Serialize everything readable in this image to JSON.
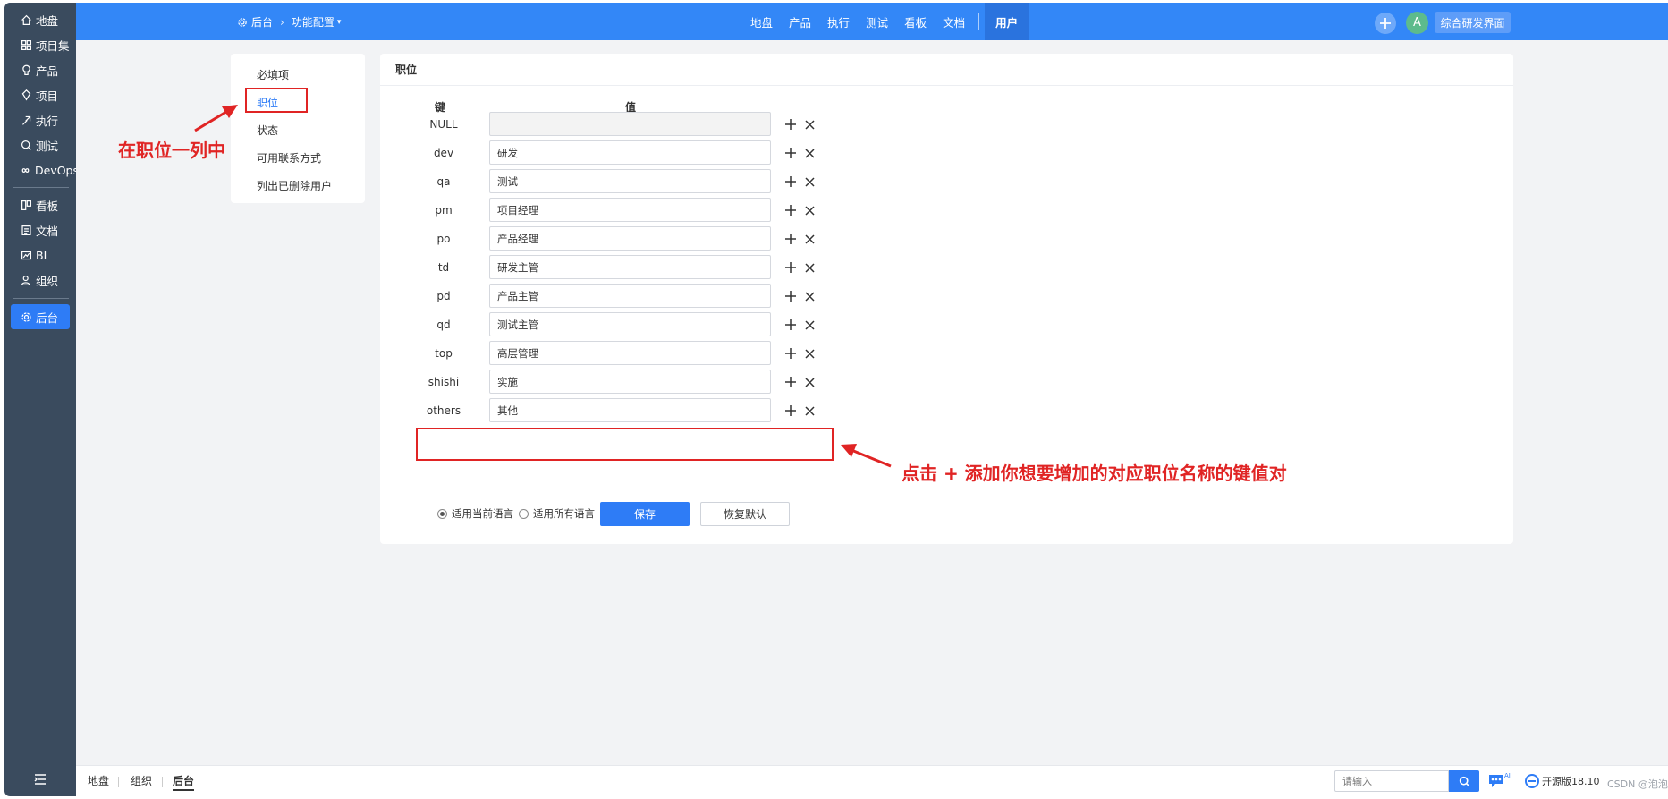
{
  "sidebar": {
    "items": [
      {
        "label": "地盘",
        "icon": "home-icon"
      },
      {
        "label": "项目集",
        "icon": "grid-icon"
      },
      {
        "label": "产品",
        "icon": "lightbulb-icon"
      },
      {
        "label": "项目",
        "icon": "project-icon"
      },
      {
        "label": "执行",
        "icon": "run-icon"
      },
      {
        "label": "测试",
        "icon": "test-icon"
      },
      {
        "label": "DevOps",
        "icon": "infinity-icon"
      },
      {
        "label": "看板",
        "icon": "kanban-icon"
      },
      {
        "label": "文档",
        "icon": "doc-icon"
      },
      {
        "label": "BI",
        "icon": "chart-icon"
      },
      {
        "label": "组织",
        "icon": "users-icon"
      },
      {
        "label": "后台",
        "icon": "gear-icon"
      }
    ],
    "active": "后台"
  },
  "header": {
    "breadcrumb": {
      "root": "后台",
      "current": "功能配置"
    },
    "nav": [
      "地盘",
      "产品",
      "执行",
      "测试",
      "看板",
      "文档"
    ],
    "active_tab": "用户",
    "avatar_letter": "A",
    "workspace_label": "综合研发界面"
  },
  "settings_menu": {
    "items": [
      "必填项",
      "职位",
      "状态",
      "可用联系方式",
      "列出已删除用户"
    ],
    "active": "职位"
  },
  "form": {
    "title": "职位",
    "key_header": "键",
    "value_header": "值",
    "rows": [
      {
        "key": "NULL",
        "value": ""
      },
      {
        "key": "dev",
        "value": "研发"
      },
      {
        "key": "qa",
        "value": "测试"
      },
      {
        "key": "pm",
        "value": "项目经理"
      },
      {
        "key": "po",
        "value": "产品经理"
      },
      {
        "key": "td",
        "value": "研发主管"
      },
      {
        "key": "pd",
        "value": "产品主管"
      },
      {
        "key": "qd",
        "value": "测试主管"
      },
      {
        "key": "top",
        "value": "高层管理"
      },
      {
        "key": "shishi",
        "value": "实施"
      },
      {
        "key": "others",
        "value": "其他"
      }
    ],
    "lang_current": "适用当前语言",
    "lang_all": "适用所有语言",
    "save_label": "保存",
    "reset_label": "恢复默认"
  },
  "annotations": {
    "left_note": "在职位一列中",
    "right_note": "点击 + 添加你想要增加的对应职位名称的键值对",
    "color": "#e02424"
  },
  "bottombar": {
    "tabs": [
      "地盘",
      "组织",
      "后台"
    ],
    "active": "后台",
    "search_placeholder": "请输入",
    "brand": "开源版18.10",
    "watermark": "CSDN @泡泡"
  },
  "colors": {
    "primary": "#3387f7",
    "sidebar": "#3a4b5e",
    "active": "#2e7cf6"
  }
}
